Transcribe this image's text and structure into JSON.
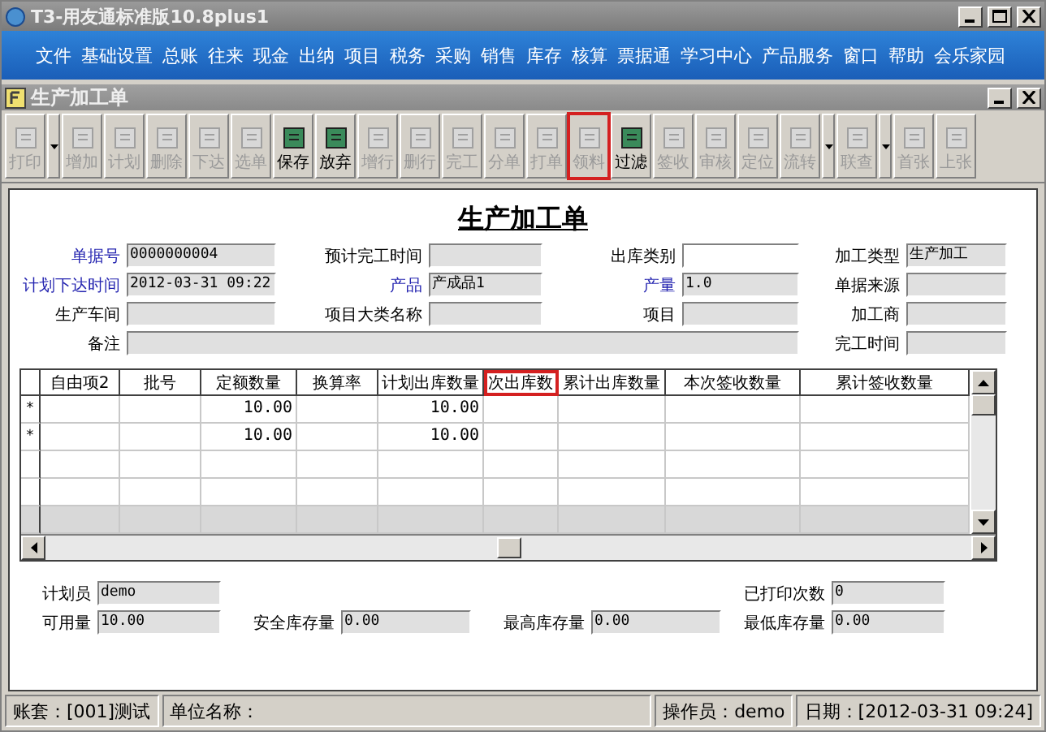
{
  "window": {
    "title": "T3-用友通标准版10.8plus1"
  },
  "menu": [
    "文件",
    "基础设置",
    "总账",
    "往来",
    "现金",
    "出纳",
    "项目",
    "税务",
    "采购",
    "销售",
    "库存",
    "核算",
    "票据通",
    "学习中心",
    "产品服务",
    "窗口",
    "帮助",
    "会乐家园"
  ],
  "child_window": {
    "title": "生产加工单"
  },
  "toolbar": [
    {
      "label": "打印",
      "disabled": true,
      "dropdown": true,
      "highlighted": false
    },
    {
      "label": "增加",
      "disabled": true,
      "dropdown": false,
      "highlighted": false
    },
    {
      "label": "计划",
      "disabled": true,
      "dropdown": false,
      "highlighted": false
    },
    {
      "label": "删除",
      "disabled": true,
      "dropdown": false,
      "highlighted": false
    },
    {
      "label": "下达",
      "disabled": true,
      "dropdown": false,
      "highlighted": false
    },
    {
      "label": "选单",
      "disabled": true,
      "dropdown": false,
      "highlighted": false
    },
    {
      "label": "保存",
      "disabled": false,
      "dropdown": false,
      "highlighted": false
    },
    {
      "label": "放弃",
      "disabled": false,
      "dropdown": false,
      "highlighted": false
    },
    {
      "label": "增行",
      "disabled": true,
      "dropdown": false,
      "highlighted": false
    },
    {
      "label": "删行",
      "disabled": true,
      "dropdown": false,
      "highlighted": false
    },
    {
      "label": "完工",
      "disabled": true,
      "dropdown": false,
      "highlighted": false
    },
    {
      "label": "分单",
      "disabled": true,
      "dropdown": false,
      "highlighted": false
    },
    {
      "label": "打单",
      "disabled": true,
      "dropdown": false,
      "highlighted": false
    },
    {
      "label": "领料",
      "disabled": true,
      "dropdown": false,
      "highlighted": true
    },
    {
      "label": "过滤",
      "disabled": false,
      "dropdown": false,
      "highlighted": false
    },
    {
      "label": "签收",
      "disabled": true,
      "dropdown": false,
      "highlighted": false
    },
    {
      "label": "审核",
      "disabled": true,
      "dropdown": false,
      "highlighted": false
    },
    {
      "label": "定位",
      "disabled": true,
      "dropdown": false,
      "highlighted": false
    },
    {
      "label": "流转",
      "disabled": true,
      "dropdown": true,
      "highlighted": false
    },
    {
      "label": "联查",
      "disabled": true,
      "dropdown": true,
      "highlighted": false
    },
    {
      "label": "首张",
      "disabled": true,
      "dropdown": false,
      "highlighted": false
    },
    {
      "label": "上张",
      "disabled": true,
      "dropdown": false,
      "highlighted": false
    }
  ],
  "form": {
    "title": "生产加工单",
    "header_fields": [
      {
        "label": "单据号",
        "value": "0000000004",
        "required": true,
        "editable": false
      },
      {
        "label": "预计完工时间",
        "required": false,
        "editable": false
      },
      {
        "label": "出库类别",
        "required": false,
        "editable": true
      },
      {
        "label": "加工类型",
        "value": "生产加工",
        "required": false,
        "editable": false
      },
      {
        "label": "计划下达时间",
        "value": "2012-03-31 09:22",
        "required": true,
        "editable": false
      },
      {
        "label": "产品",
        "value": "产成品1",
        "required": true,
        "editable": false
      },
      {
        "label": "产量",
        "value": "1.0",
        "required": true,
        "editable": false
      },
      {
        "label": "单据来源",
        "required": false,
        "editable": false
      },
      {
        "label": "生产车间",
        "required": false,
        "editable": false
      },
      {
        "label": "项目大类名称",
        "required": false,
        "editable": false
      },
      {
        "label": "项目",
        "required": false,
        "editable": false
      },
      {
        "label": "加工商",
        "required": false,
        "editable": false
      },
      {
        "label": "备注",
        "required": false,
        "editable": false
      },
      {
        "label": "完工时间",
        "required": false,
        "editable": false
      }
    ],
    "table": {
      "columns": [
        {
          "label": "自由项2",
          "highlighted": false
        },
        {
          "label": "批号",
          "highlighted": false
        },
        {
          "label": "定额数量",
          "highlighted": false
        },
        {
          "label": "换算率",
          "highlighted": false
        },
        {
          "label": "计划出库数量",
          "highlighted": false
        },
        {
          "label": "次出库数",
          "highlighted": true
        },
        {
          "label": "累计出库数量",
          "highlighted": false
        },
        {
          "label": "本次签收数量",
          "highlighted": false
        },
        {
          "label": "累计签收数量",
          "highlighted": false
        }
      ],
      "rows": [
        {
          "marker": "*",
          "cells": [
            "",
            "",
            "10.00",
            "",
            "10.00",
            "",
            "",
            "",
            ""
          ]
        },
        {
          "marker": "*",
          "cells": [
            "",
            "",
            "10.00",
            "",
            "10.00",
            "",
            "",
            "",
            ""
          ]
        },
        {
          "cells": [
            "",
            "",
            "",
            "",
            "",
            "",
            "",
            "",
            ""
          ]
        },
        {
          "cells": [
            "",
            "",
            "",
            "",
            "",
            "",
            "",
            "",
            ""
          ]
        },
        {
          "cells": [
            "",
            "",
            "",
            "",
            "",
            "",
            "",
            "",
            ""
          ]
        }
      ]
    },
    "footer_fields": [
      {
        "label": "计划员",
        "value": "demo"
      },
      {
        "label": "已打印次数",
        "value": "0"
      },
      {
        "label": "可用量",
        "value": "10.00"
      },
      {
        "label": "安全库存量",
        "value": "0.00"
      },
      {
        "label": "最高库存量",
        "value": "0.00"
      },
      {
        "label": "最低库存量",
        "value": "0.00"
      }
    ]
  },
  "status_bar": [
    "账套：[001]测试",
    "单位名称：",
    "操作员：demo",
    "日期：[2012-03-31 09:24]"
  ]
}
